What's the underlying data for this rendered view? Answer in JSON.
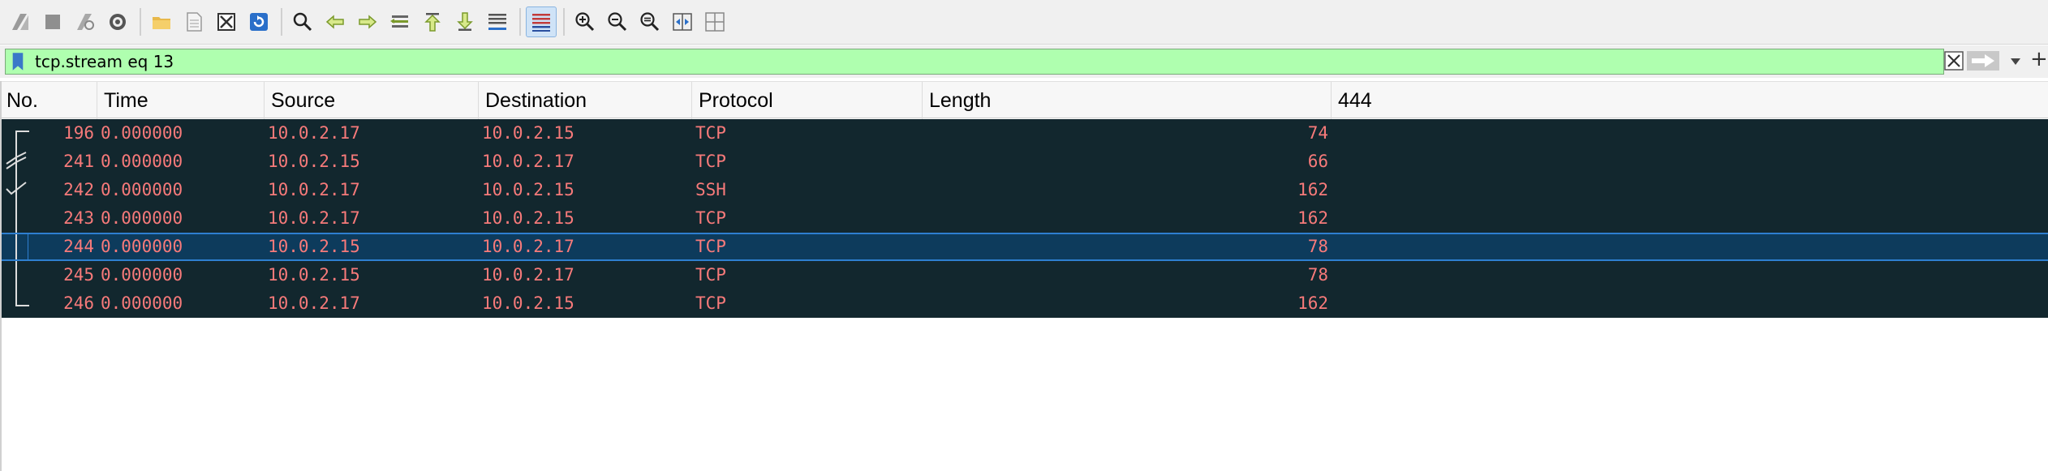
{
  "toolbar": {
    "buttons": [
      {
        "name": "start-capture-icon"
      },
      {
        "name": "stop-capture-icon"
      },
      {
        "name": "restart-capture-icon"
      },
      {
        "name": "capture-options-icon"
      },
      {
        "name": "open-file-icon"
      },
      {
        "name": "save-file-icon"
      },
      {
        "name": "close-file-icon"
      },
      {
        "name": "reload-file-icon"
      },
      {
        "name": "find-packet-icon"
      },
      {
        "name": "go-back-icon"
      },
      {
        "name": "go-forward-icon"
      },
      {
        "name": "go-to-packet-icon"
      },
      {
        "name": "go-first-icon"
      },
      {
        "name": "go-last-icon"
      },
      {
        "name": "auto-scroll-icon"
      },
      {
        "name": "colorize-icon"
      },
      {
        "name": "zoom-in-icon"
      },
      {
        "name": "zoom-out-icon"
      },
      {
        "name": "zoom-normal-icon"
      },
      {
        "name": "resize-columns-icon"
      },
      {
        "name": "layout-icon"
      }
    ]
  },
  "filter": {
    "value": "tcp.stream eq 13",
    "plus": "+",
    "colors": {
      "background": "#afffaf"
    }
  },
  "columns": {
    "no": "No.",
    "time": "Time",
    "source": "Source",
    "destination": "Destination",
    "protocol": "Protocol",
    "length": "Length",
    "extra": "444"
  },
  "packets": [
    {
      "no": "196",
      "time": "0.000000",
      "source": "10.0.2.17",
      "destination": "10.0.2.15",
      "protocol": "TCP",
      "length": "74"
    },
    {
      "no": "241",
      "time": "0.000000",
      "source": "10.0.2.15",
      "destination": "10.0.2.17",
      "protocol": "TCP",
      "length": "66"
    },
    {
      "no": "242",
      "time": "0.000000",
      "source": "10.0.2.17",
      "destination": "10.0.2.15",
      "protocol": "SSH",
      "length": "162"
    },
    {
      "no": "243",
      "time": "0.000000",
      "source": "10.0.2.17",
      "destination": "10.0.2.15",
      "protocol": "TCP",
      "length": "162"
    },
    {
      "no": "244",
      "time": "0.000000",
      "source": "10.0.2.15",
      "destination": "10.0.2.17",
      "protocol": "TCP",
      "length": "78"
    },
    {
      "no": "245",
      "time": "0.000000",
      "source": "10.0.2.15",
      "destination": "10.0.2.17",
      "protocol": "TCP",
      "length": "78"
    },
    {
      "no": "246",
      "time": "0.000000",
      "source": "10.0.2.17",
      "destination": "10.0.2.15",
      "protocol": "TCP",
      "length": "162"
    }
  ],
  "selected_packet": "244",
  "colors": {
    "row_bg": "#12272e",
    "row_text": "#f77a7a",
    "selected_bg": "#0d3b5c"
  }
}
